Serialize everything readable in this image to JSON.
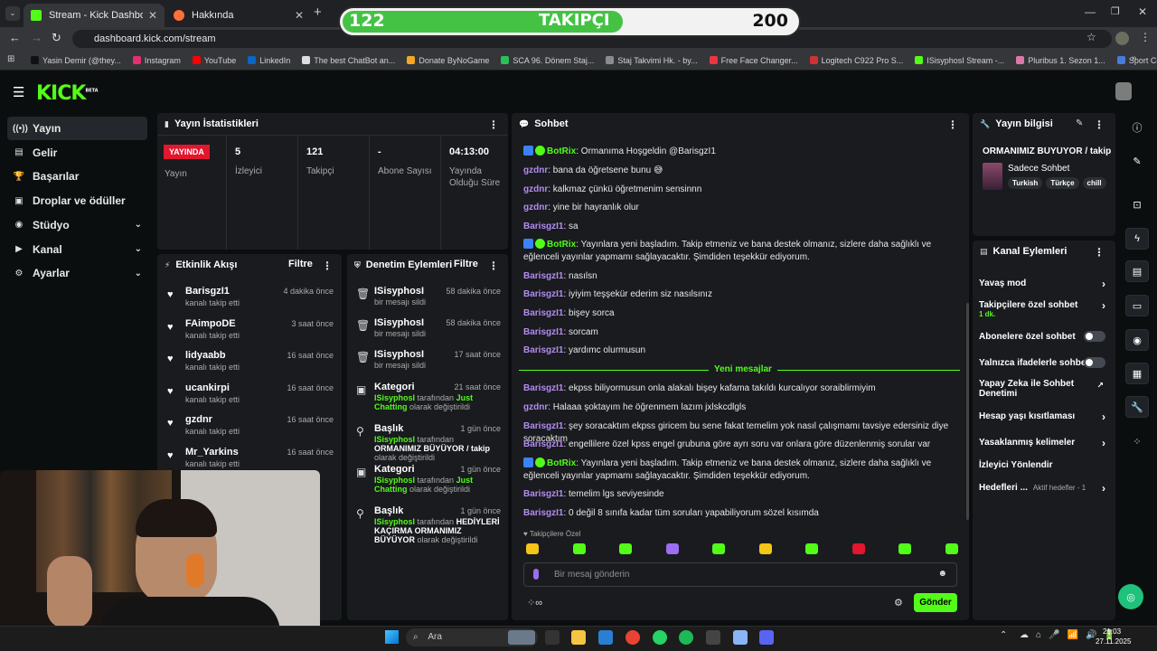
{
  "browser": {
    "tabs": [
      {
        "title": "Stream - Kick Dashboard"
      },
      {
        "title": "Hakkında"
      }
    ],
    "url": "dashboard.kick.com/stream",
    "bookmarks": [
      "Yasin Demir (@they...",
      "Instagram",
      "YouTube",
      "LinkedIn",
      "The best ChatBot an...",
      "Donate ByNoGame",
      "SCA 96. Dönem Staj...",
      "Staj Takvimi Hk. - by...",
      "Free Face Changer...",
      "Logitech C922 Pro S...",
      "ISisyphosI Stream -...",
      "Pluribus 1. Sezon 1...",
      "Sport Center Acade..."
    ]
  },
  "goal": {
    "current": "122",
    "label": "TAKIPÇI",
    "target": "200",
    "progress": 0.61
  },
  "kick": {
    "logo": "KICK",
    "beta": "BETA"
  },
  "sidebar": {
    "items": [
      {
        "label": "Yayın",
        "icon": "broadcast-icon"
      },
      {
        "label": "Gelir",
        "icon": "wallet-icon"
      },
      {
        "label": "Başarılar",
        "icon": "trophy-icon"
      },
      {
        "label": "Droplar ve ödüller",
        "icon": "gift-icon"
      },
      {
        "label": "Stüdyo",
        "icon": "studio-icon"
      },
      {
        "label": "Kanal",
        "icon": "channel-icon"
      },
      {
        "label": "Ayarlar",
        "icon": "gear-icon"
      }
    ]
  },
  "stats": {
    "title": "Yayın İstatistikleri",
    "live_badge": "YAYINDA",
    "live_label": "Yayın",
    "items": [
      {
        "value": "5",
        "label": "İzleyici"
      },
      {
        "value": "121",
        "label": "Takipçi"
      },
      {
        "value": "-",
        "label": "Abone Sayısı"
      },
      {
        "value": "04:13:00",
        "label": "Yayında Olduğu Süre"
      }
    ]
  },
  "activity": {
    "title": "Etkinlik Akışı",
    "filter": "Filtre",
    "items": [
      {
        "name": "BarisgzI1",
        "sub": "kanalı takip etti",
        "time": "4 dakika önce"
      },
      {
        "name": "FAimpoDE",
        "sub": "kanalı takip etti",
        "time": "3 saat önce"
      },
      {
        "name": "lidyaabb",
        "sub": "kanalı takip etti",
        "time": "16 saat önce"
      },
      {
        "name": "ucankirpi",
        "sub": "kanalı takip etti",
        "time": "16 saat önce"
      },
      {
        "name": "gzdnr",
        "sub": "kanalı takip etti",
        "time": "16 saat önce"
      },
      {
        "name": "Mr_Yarkins",
        "sub": "kanalı takip etti",
        "time": "16 saat önce"
      }
    ]
  },
  "moderation": {
    "title": "Denetim Eylemleri",
    "filter": "Filtre",
    "items": [
      {
        "name": "ISisyphosI",
        "sub": "bir mesajı sildi",
        "time": "58 dakika önce"
      },
      {
        "name": "ISisyphosI",
        "sub": "bir mesajı sildi",
        "time": "58 dakika önce"
      },
      {
        "name": "ISisyphosI",
        "sub": "bir mesajı sildi",
        "time": "17 saat önce"
      },
      {
        "name": "Kategori",
        "actor": "ISisyphosI",
        "mid": "tarafından",
        "value": "Just Chatting",
        "sub": "olarak değiştirildi",
        "time": "21 saat önce"
      },
      {
        "name": "Başlık",
        "actor": "ISisyphosI",
        "mid": "tarafından",
        "value": "ORMANIMIZ BÜYÜYOR / takip",
        "sub": "olarak değiştirildi",
        "time": "1 gün önce"
      },
      {
        "name": "Kategori",
        "actor": "ISisyphosI",
        "mid": "tarafından",
        "value": "Just Chatting",
        "sub": "olarak değiştirildi",
        "time": "1 gün önce"
      },
      {
        "name": "Başlık",
        "actor": "ISisyphosI",
        "mid": "tarafından",
        "value": "HEDİYLERİ KAÇIRMA ORMANIMIZ BÜYÜYOR",
        "sub": "olarak değiştirildi",
        "time": "1 gün önce"
      }
    ]
  },
  "chat": {
    "title": "Sohbet",
    "new_messages": "Yeni mesajlar",
    "messages": [
      {
        "user": "BotRix",
        "bot": true,
        "text": ": Ormanıma Hoşgeldin @BarisgzI1"
      },
      {
        "user": "gzdnr",
        "text": ": bana da öğretsene bunu 😅"
      },
      {
        "user": "gzdnr",
        "text": ": kalkmaz çünkü öğretmenim sensinnn"
      },
      {
        "user": "gzdnr",
        "text": ": yine bir hayranlık olur"
      },
      {
        "user": "BarisgzI1",
        "text": ": sa"
      },
      {
        "user": "BotRix",
        "bot": true,
        "text": ": Yayınlara yeni başladım. Takip etmeniz ve bana destek olmanız, sizlere daha sağlıklı ve eğlenceli yayınlar yapmamı sağlayacaktır. Şimdiden teşekkür ediyorum."
      },
      {
        "user": "BarisgzI1",
        "text": ": nasılsn"
      },
      {
        "user": "BarisgzI1",
        "text": ": iyiyim teşşekür ederim siz nasılsınız"
      },
      {
        "user": "BarisgzI1",
        "text": ": bişey sorca"
      },
      {
        "user": "BarisgzI1",
        "text": ": sorcam"
      },
      {
        "user": "BarisgzI1",
        "text": ": yardımc olurmusun"
      },
      {
        "user": "BarisgzI1",
        "text": ": ekpss biliyormusun onla alakalı bişey kafama takıldı kurcalıyor soraiblirmiyim"
      },
      {
        "user": "gzdnr",
        "text": ": Halaaa şoktayım he öğrenmem lazım jxlskcdlgls"
      },
      {
        "user": "BarisgzI1",
        "text": ": şey soracaktım ekpss giricem bu sene fakat temelim yok nasıl çalışmamı tavsiye edersiniz diye soracaktım"
      },
      {
        "user": "BarisgzI1",
        "text": ": engellilere özel kpss engel grubuna göre ayrı soru var onlara göre düzenlenmiş sorular var"
      },
      {
        "user": "BotRix",
        "bot": true,
        "text": ": Yayınlara yeni başladım. Takip etmeniz ve bana destek olmanız, sizlere daha sağlıklı ve eğlenceli yayınlar yapmamı sağlayacaktır. Şimdiden teşekkür ediyorum."
      },
      {
        "user": "BarisgzI1",
        "text": ": temelim lgs seviyesinde"
      },
      {
        "user": "BarisgzI1",
        "text": ": 0 değil 8 sınıfa kadar tüm soruları yapabiliyorum sözel kısımda"
      }
    ],
    "emote_label": "Takipçilere Özel",
    "input_placeholder": "Bir mesaj gönderin",
    "send": "Gönder"
  },
  "stream_info": {
    "title": "Yayın bilgisi",
    "stream_title": "ORMANIMIZ BÜYÜYOR / takip",
    "category": "Sadece Sohbet",
    "tags": [
      "Turkish",
      "Türkçe",
      "chill"
    ]
  },
  "channel_actions": {
    "title": "Kanal Eylemleri",
    "items": [
      {
        "label": "Yavaş mod",
        "kind": "chevron"
      },
      {
        "label": "Takipçilere özel sohbet",
        "sub": "1 dk.",
        "kind": "chevron"
      },
      {
        "label": "Abonelere özel sohbet",
        "kind": "toggle"
      },
      {
        "label": "Yalnızca ifadelerle sohbet",
        "kind": "toggle"
      },
      {
        "label": "Yapay Zeka ile Sohbet Denetimi",
        "kind": "external"
      },
      {
        "label": "Hesap yaşı kısıtlaması",
        "kind": "chevron"
      },
      {
        "label": "Yasaklanmış kelimeler",
        "kind": "chevron"
      },
      {
        "label": "İzleyici Yönlendir",
        "kind": "none"
      },
      {
        "label": "Hedefleri ...",
        "sub": "Aktif hedefler - 1",
        "kind": "chevron"
      }
    ]
  },
  "taskbar": {
    "search": "Ara",
    "time": "21:03",
    "date": "27.11.2025"
  },
  "colors": {
    "accent": "#53fc18",
    "panel": "#191b1f",
    "bg": "#0b0e0f",
    "live": "#e2162d",
    "chat_user": "#b48cf0"
  }
}
